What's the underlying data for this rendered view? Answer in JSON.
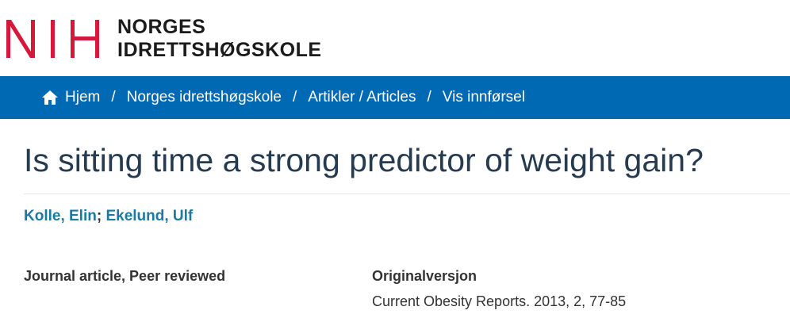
{
  "logo": {
    "mark": "NIH",
    "line1": "NORGES",
    "line2": "IDRETTSHØGSKOLE",
    "mark_color": "#d6193b"
  },
  "breadcrumb": {
    "home_icon": "home-icon",
    "items": [
      "Hjem",
      "Norges idrettshøgskole",
      "Artikler / Articles",
      "Vis innførsel"
    ],
    "separator": "/",
    "bar_color": "#0069b4"
  },
  "article": {
    "title": "Is sitting time a strong predictor of weight gain?",
    "authors": [
      "Kolle, Elin",
      "Ekelund, Ulf"
    ],
    "author_separator": ";",
    "type": "Journal article, Peer reviewed",
    "original_version_heading": "Originalversjon",
    "original_version_value": "Current Obesity Reports. 2013, 2, 77-85"
  }
}
